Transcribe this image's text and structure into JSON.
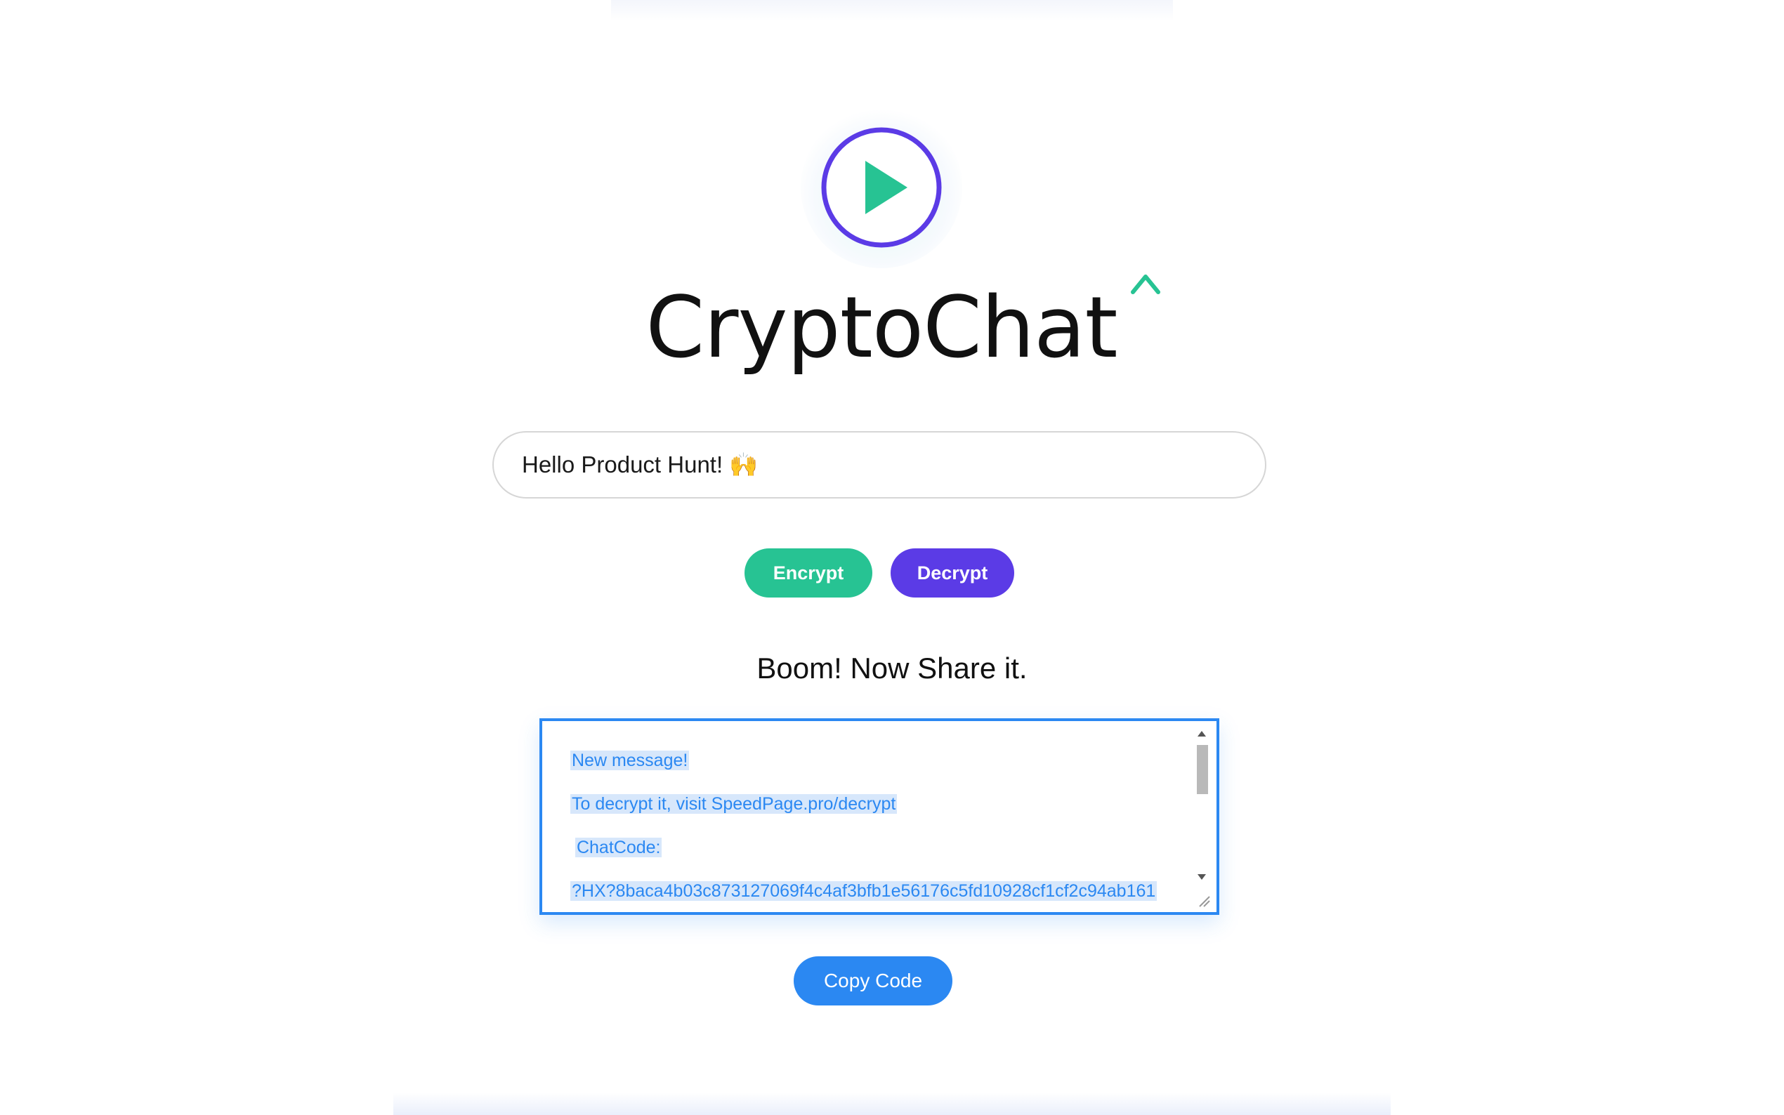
{
  "brand": {
    "name": "CryptoChat",
    "accent_caret": "^",
    "logo_icon": "play-circle-icon",
    "colors": {
      "ring": "#5b3be6",
      "play": "#27c393",
      "caret": "#27c393"
    }
  },
  "message_input": {
    "value": "Hello Product Hunt! 🙌"
  },
  "actions": {
    "encrypt_label": "Encrypt",
    "decrypt_label": "Decrypt",
    "copy_label": "Copy Code",
    "colors": {
      "encrypt": "#27c393",
      "decrypt": "#5b3be6",
      "copy": "#2b88f2"
    }
  },
  "result": {
    "heading": "Boom! Now Share it.",
    "lines": [
      "New message!",
      "To decrypt it, visit SpeedPage.pro/decrypt",
      "ChatCode:",
      "?HX?8baca4b03c873127069f4c4af3bfb1e56176c5fd10928cf1cf2c94ab161"
    ]
  }
}
